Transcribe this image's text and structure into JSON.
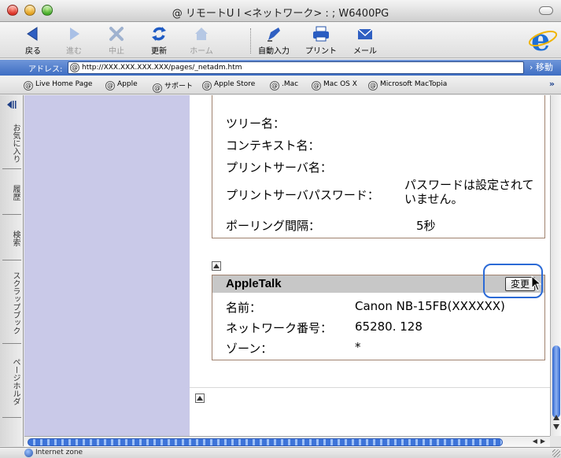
{
  "window": {
    "title": "@ リモートU I <ネットワーク> : ; W6400PG"
  },
  "toolbar": {
    "back": "戻る",
    "forward": "進む",
    "stop": "中止",
    "refresh": "更新",
    "home": "ホーム",
    "autofill": "自動入力",
    "print": "プリント",
    "mail": "メール"
  },
  "address": {
    "label": "アドレス:",
    "url": "http://XXX.XXX.XXX.XXX/pages/_netadm.htm",
    "go": "移動"
  },
  "favorites": {
    "items": [
      "Live Home Page",
      "Apple",
      "サポート",
      "Apple Store",
      ".Mac",
      "Mac OS X",
      "Microsoft MacTopia"
    ],
    "more": "»"
  },
  "side_tabs": [
    "お気に入り",
    "履歴",
    "検索",
    "スクラップブック",
    "ページホルダ"
  ],
  "netware": {
    "tree_label": "ツリー名：",
    "context_label": "コンテキスト名：",
    "print_server_label": "プリントサーバ名：",
    "password_label": "プリントサーバパスワード：",
    "password_value_line1": "パスワードは設定されて",
    "password_value_line2": "いません。",
    "polling_label": "ポーリング間隔：",
    "polling_value": "5秒"
  },
  "appletalk": {
    "title": "AppleTalk",
    "change_button": "変更",
    "name_label": "名前：",
    "name_value": "Canon NB-15FB(XXXXXX)",
    "network_label": "ネットワーク番号：",
    "network_value": "65280. 128",
    "zone_label": "ゾーン：",
    "zone_value": "*"
  },
  "status": {
    "text": "Internet zone"
  },
  "colors": {
    "address_bar": "#4a78c9",
    "left_pane": "#c9c9e8",
    "section_border": "#a0826f",
    "section_header": "#c7c7c7",
    "highlight": "#2b6ad6",
    "scroll_thumb": "#3d74d9"
  }
}
